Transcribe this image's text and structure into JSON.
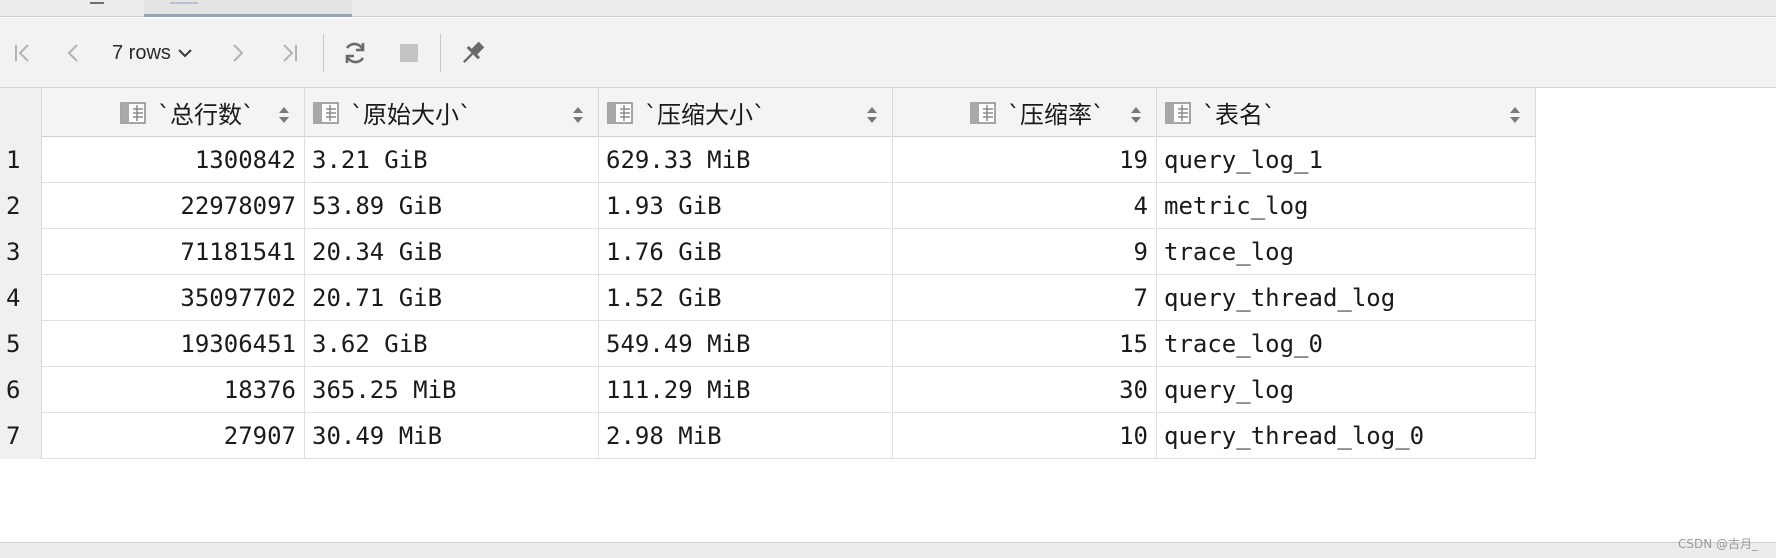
{
  "toolbar": {
    "rows_label": "7 rows"
  },
  "table": {
    "columns": [
      {
        "label": "`总行数`"
      },
      {
        "label": "`原始大小`"
      },
      {
        "label": "`压缩大小`"
      },
      {
        "label": "`压缩率`"
      },
      {
        "label": "`表名`"
      }
    ],
    "rows": [
      {
        "num": "1",
        "total_rows": "1300842",
        "raw_size": "3.21 GiB",
        "compressed_size": "629.33 MiB",
        "ratio": "19",
        "table_name": "query_log_1"
      },
      {
        "num": "2",
        "total_rows": "22978097",
        "raw_size": "53.89 GiB",
        "compressed_size": "1.93 GiB",
        "ratio": "4",
        "table_name": "metric_log"
      },
      {
        "num": "3",
        "total_rows": "71181541",
        "raw_size": "20.34 GiB",
        "compressed_size": "1.76 GiB",
        "ratio": "9",
        "table_name": "trace_log"
      },
      {
        "num": "4",
        "total_rows": "35097702",
        "raw_size": "20.71 GiB",
        "compressed_size": "1.52 GiB",
        "ratio": "7",
        "table_name": "query_thread_log"
      },
      {
        "num": "5",
        "total_rows": "19306451",
        "raw_size": "3.62 GiB",
        "compressed_size": "549.49 MiB",
        "ratio": "15",
        "table_name": "trace_log_0"
      },
      {
        "num": "6",
        "total_rows": "18376",
        "raw_size": "365.25 MiB",
        "compressed_size": "111.29 MiB",
        "ratio": "30",
        "table_name": "query_log"
      },
      {
        "num": "7",
        "total_rows": "27907",
        "raw_size": "30.49 MiB",
        "compressed_size": "2.98 MiB",
        "ratio": "10",
        "table_name": "query_thread_log_0"
      }
    ]
  },
  "watermark": "CSDN @古月_",
  "icons": {
    "first": "first-page-icon",
    "prev": "previous-page-icon",
    "next": "next-page-icon",
    "last": "last-page-icon",
    "reload": "reload-icon",
    "stop": "stop-icon",
    "pin": "pin-icon",
    "column": "table-column-icon",
    "sort": "sort-icon"
  }
}
